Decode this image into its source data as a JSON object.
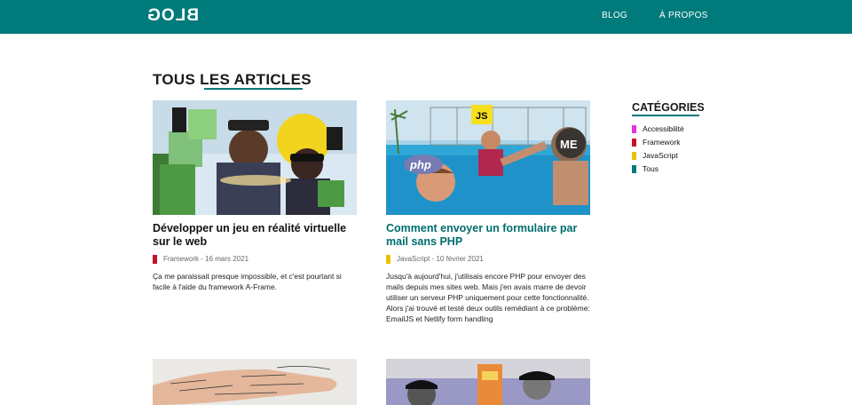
{
  "header": {
    "logo": "BLOG",
    "nav": [
      {
        "label": "BLOG"
      },
      {
        "label": "À PROPOS"
      }
    ],
    "color": "#007a7a"
  },
  "main": {
    "title": "TOUS LES ARTICLES",
    "articles": [
      {
        "title": "Développer un jeu en réalité virtuelle sur le web",
        "meta": "Framework - 16 mars 2021",
        "category_color": "#c8102e",
        "excerpt": "Ça me paraissait presque impossible, et c'est pourtant si facile à l'aide du framework A-Frame.",
        "image_badges": []
      },
      {
        "title": "Comment envoyer un formulaire par mail sans PHP",
        "meta": "JavaScript - 10 février 2021",
        "category_color": "#e6c300",
        "excerpt": "Jusqu'à aujourd'hui, j'utilisais encore PHP pour envoyer des mails depuis mes sites web. Mais j'en avais marre de devoir utiliser un serveur PHP uniquement pour cette fonctionnalité. Alors j'ai trouvé et testé deux outils remédiant à ce problème: EmailJS et Netlify form handling",
        "image_badges": [
          "JS",
          "ME",
          "php"
        ]
      }
    ]
  },
  "sidebar": {
    "title": "CATÉGORIES",
    "items": [
      {
        "label": "Accessibilité",
        "color": "#e533d8"
      },
      {
        "label": "Framework",
        "color": "#c8102e"
      },
      {
        "label": "JavaScript",
        "color": "#e6c300"
      },
      {
        "label": "Tous",
        "color": "#007a7a"
      }
    ]
  }
}
